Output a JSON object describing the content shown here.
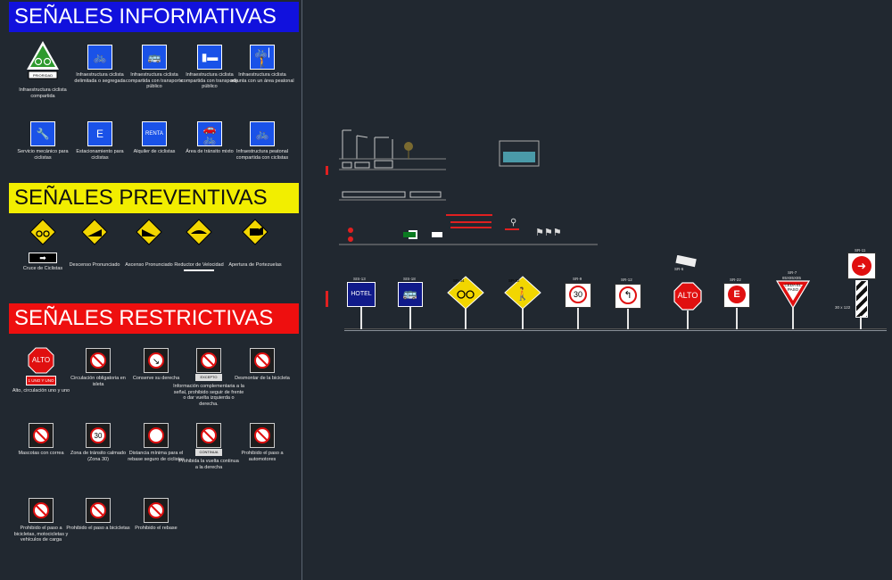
{
  "sections": {
    "informativas": "SEÑALES INFORMATIVAS",
    "preventivas": "SEÑALES PREVENTIVAS",
    "restrictivas": "SEÑALES RESTRICTIVAS"
  },
  "informativas": [
    {
      "caption": "Infraestructura ciclista compartida",
      "icon": "bicycle-icon",
      "plate": "PRIORIDAD"
    },
    {
      "caption": "Infraestructura ciclista delimitada o segregada",
      "icon": "bicycle-icon"
    },
    {
      "caption": "Infraestructura ciclista compartida con transporte público",
      "icon": "bus-bicycle-icon"
    },
    {
      "caption": "Infraestructura ciclista compartida con transporte público",
      "icon": "bus-lane-icon"
    },
    {
      "caption": "Infraestructura ciclista adjunta con un área peatonal",
      "icon": "bike-pedestrian-icon"
    },
    {
      "caption": "Servicio mecánico para ciclistas",
      "icon": "wrench-bike-icon"
    },
    {
      "caption": "Estacionamiento para ciclistas",
      "icon": "bike-parking-icon",
      "letter": "E"
    },
    {
      "caption": "Alquiler de ciclistas",
      "icon": "bike-rental-icon",
      "letter": "RENTA"
    },
    {
      "caption": "Área de tránsito mixto",
      "icon": "mixed-traffic-icon"
    },
    {
      "caption": "Infraestructura peatonal compartida con ciclistas",
      "icon": "pedestrian-bike-icon"
    }
  ],
  "preventivas": [
    {
      "caption": "Cruce de Ciclistas",
      "icon": "bicycle-icon"
    },
    {
      "caption": "Descenso Pronunciado",
      "icon": "descent-icon"
    },
    {
      "caption": "Ascenso Pronunciado",
      "icon": "ascent-icon"
    },
    {
      "caption": "Reductor de Velocidad",
      "icon": "speed-bump-icon"
    },
    {
      "caption": "Apertura de Portezuelas",
      "icon": "car-door-icon"
    }
  ],
  "restrictivas": [
    {
      "caption": "Alto, circulación uno y uno",
      "icon": "stop-icon",
      "label": "ALTO",
      "plate": "1 UNO Y UNO"
    },
    {
      "caption": "Circulación obligatoria en isleta",
      "icon": "mandatory-icon"
    },
    {
      "caption": "Conserve su derecha",
      "icon": "keep-right-icon"
    },
    {
      "caption": "Información complementaria a la señal, prohibido seguir de frente o dar vuelta izquierda o derecha.",
      "icon": "no-turn-icon",
      "plate": "EXCEPTO"
    },
    {
      "caption": "Desmontar de la bicicleta",
      "icon": "dismount-icon"
    },
    {
      "caption": "Mascotas con correa",
      "icon": "pet-leash-icon"
    },
    {
      "caption": "Zona de tránsito calmado (Zona 30)",
      "icon": "zone-30-icon",
      "label": "30"
    },
    {
      "caption": "Distancia mínima para el rebase seguro de ciclistas",
      "icon": "min-distance-icon"
    },
    {
      "caption": "Prohibida la vuelta continua a la derecha",
      "icon": "no-right-turn-icon",
      "plate": "CONTINUA"
    },
    {
      "caption": "Prohibido el paso a automotores",
      "icon": "no-cars-icon"
    },
    {
      "caption": "Prohibido el paso a bicicletas, motocicletas y vehículos de carga",
      "icon": "no-vehicles-icon"
    },
    {
      "caption": "Prohibido el paso a bicicletas",
      "icon": "no-bikes-icon"
    },
    {
      "caption": "Prohibido el rebase",
      "icon": "no-overtake-icon"
    }
  ],
  "cad_signs": [
    {
      "code": "SIS-13",
      "face": "HOTEL",
      "icon": "hotel-icon"
    },
    {
      "code": "SIS-18",
      "face": "",
      "icon": "bus-icon"
    },
    {
      "code": "SP-34",
      "face": "",
      "icon": "bicycle-icon"
    },
    {
      "code": "SP-32",
      "face": "",
      "icon": "pedestrian-icon"
    },
    {
      "code": "SR-9",
      "face": "30",
      "icon": "speed-limit-icon"
    },
    {
      "code": "SR-12",
      "face": "",
      "icon": "no-left-turn-icon"
    },
    {
      "code": "SR-6",
      "face": "ALTO",
      "icon": "stop-icon"
    },
    {
      "code": "SR-22",
      "face": "E",
      "icon": "no-parking-icon"
    },
    {
      "code": "SR-7",
      "face": "CEDA EL PASO",
      "icon": "yield-icon",
      "note": "85X85X85"
    },
    {
      "code": "SR-11",
      "face": "",
      "icon": "arrow-right-icon",
      "note": "30 x 122"
    }
  ],
  "colors": {
    "background": "#212830",
    "blue": "#1111dd",
    "yellow": "#f2ee00",
    "red": "#ee0f0f",
    "sign_blue": "#1a52e8"
  }
}
